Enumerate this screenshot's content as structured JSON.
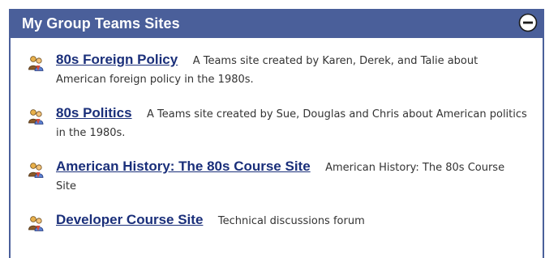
{
  "panel": {
    "title": "My Group Teams Sites",
    "collapse_icon": "minus-circle-icon"
  },
  "sites": [
    {
      "name": "80s Foreign Policy",
      "description": "A Teams site created by Karen, Derek, and Talie about American foreign policy in the 1980s.",
      "icon": "teams-people-icon"
    },
    {
      "name": "80s Politics",
      "description": "A Teams site created by Sue, Douglas and Chris about American politics in the 1980s.",
      "icon": "teams-people-icon"
    },
    {
      "name": "American History: The 80s Course Site",
      "description": "American History: The 80s Course Site",
      "icon": "teams-people-icon"
    },
    {
      "name": "Developer Course Site",
      "description": "Technical discussions forum",
      "icon": "teams-people-icon"
    }
  ],
  "colors": {
    "header_bg": "#4a5f9a",
    "link": "#1a2f7a"
  }
}
